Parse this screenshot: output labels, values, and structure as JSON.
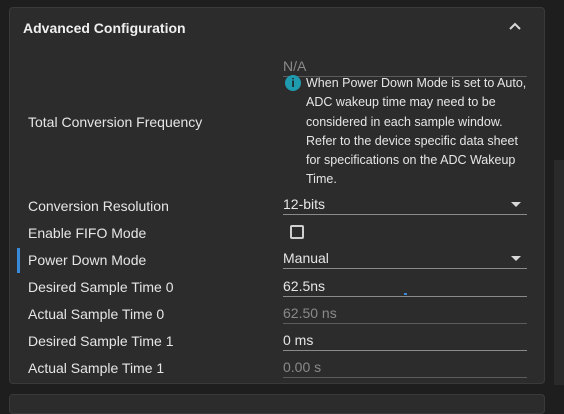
{
  "panel": {
    "title": "Advanced Configuration",
    "collapse_icon": "chevron-up-icon"
  },
  "fields": {
    "total_conversion_frequency": {
      "label": "Total Conversion Frequency",
      "value": "N/A",
      "info_icon": "info-icon",
      "info_lines": [
        "When Power Down Mode is set to Auto,",
        "ADC wakeup time may need to be",
        "considered in each sample window.",
        "Refer to the device specific data sheet",
        "for specifications on the ADC Wakeup",
        "Time."
      ]
    },
    "conversion_resolution": {
      "label": "Conversion Resolution",
      "value": "12-bits"
    },
    "enable_fifo_mode": {
      "label": "Enable FIFO Mode",
      "checked": false
    },
    "power_down_mode": {
      "label": "Power Down Mode",
      "value": "Manual"
    },
    "desired_sample_time_0": {
      "label": "Desired Sample Time 0",
      "value": "62.5ns"
    },
    "actual_sample_time_0": {
      "label": "Actual Sample Time 0",
      "value": "62.50 ns"
    },
    "desired_sample_time_1": {
      "label": "Desired Sample Time 1",
      "value": "0 ms"
    },
    "actual_sample_time_1": {
      "label": "Actual Sample Time 1",
      "value": "0.00 s"
    }
  },
  "colors": {
    "accent": "#3b8ad9",
    "info": "#1f9bb0",
    "panel_bg": "#2c2c2c",
    "page_bg": "#1e1e1e"
  }
}
